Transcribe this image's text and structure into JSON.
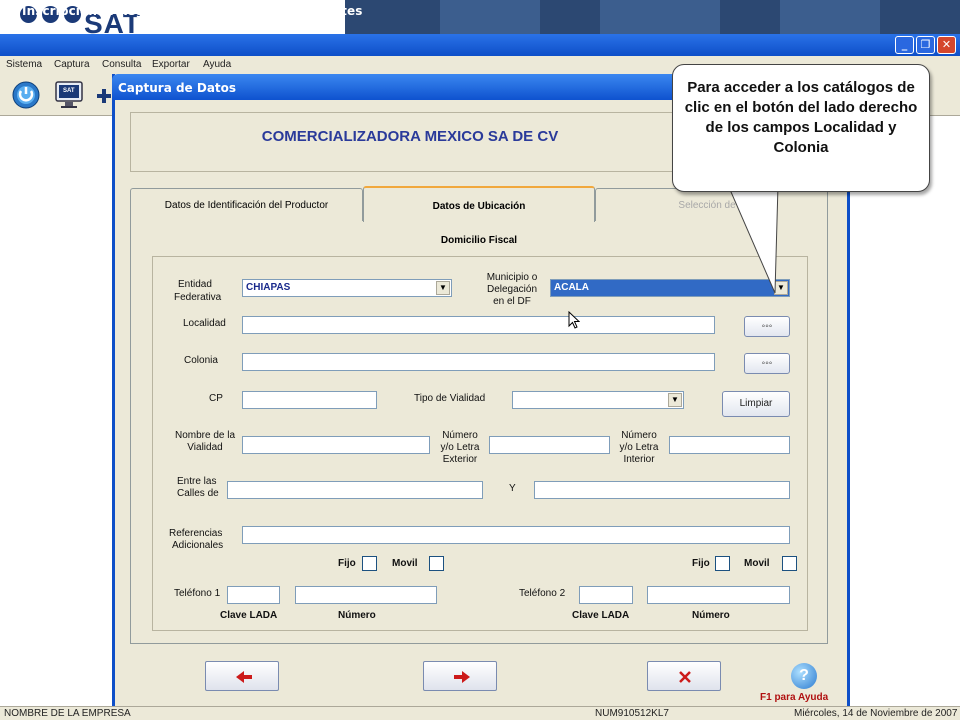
{
  "banner": {
    "logo_text": "SAT",
    "brand_color": "#1b3a78"
  },
  "window": {
    "title": "Inscripción al Registro Federal de Contribuyentes",
    "icon": "app-icon",
    "controls": {
      "minimize": "_",
      "maximize": "❐",
      "close": "✕"
    }
  },
  "menubar": {
    "items": [
      "Sistema",
      "Captura",
      "Consulta",
      "Exportar",
      "Ayuda"
    ]
  },
  "toolbar": {
    "icons": [
      "power-icon",
      "sat-icon",
      "add-icon"
    ],
    "sat_icon_label": "SAT"
  },
  "dialog": {
    "title": "Captura de Datos",
    "company": "COMERCIALIZADORA MEXICO SA DE CV",
    "tabs": [
      {
        "label": "Datos de Identificación del Productor",
        "active": false
      },
      {
        "label": "Datos de Ubicación",
        "active": true
      },
      {
        "label": "Selección de A",
        "active": false
      }
    ],
    "section_title": "Domicilio Fiscal",
    "form": {
      "entidad_label_1": "Entidad",
      "entidad_label_2": "Federativa",
      "entidad_value": "CHIAPAS",
      "municipio_label_1": "Municipio o",
      "municipio_label_2": "Delegación",
      "municipio_label_3": "en el DF",
      "municipio_value": "ACALA",
      "localidad_label": "Localidad",
      "colonia_label": "Colonia",
      "ellipsis_label": "◦◦◦",
      "cp_label": "CP",
      "tipo_vialidad_label": "Tipo de Vialidad",
      "limpiar_label": "Limpiar",
      "nombre_vialidad_1": "Nombre de la",
      "nombre_vialidad_2": "Vialidad",
      "numero_ext_1": "Número",
      "numero_ext_2": "y/o Letra",
      "numero_ext_3": "Exterior",
      "numero_int_1": "Número",
      "numero_int_2": "y/o Letra",
      "numero_int_3": "Interior",
      "entre_calles_1": "Entre las",
      "entre_calles_2": "Calles de",
      "y_label": "Y",
      "referencias_1": "Referencias",
      "referencias_2": "Adicionales",
      "fijo_label": "Fijo",
      "movil_label": "Movil",
      "telefono1_label": "Teléfono 1",
      "telefono2_label": "Teléfono 2",
      "clave_lada_label": "Clave LADA",
      "numero_label": "Número"
    },
    "nav": {
      "back_icon": "arrow-left-icon",
      "next_icon": "arrow-right-icon",
      "cancel_icon": "x-icon"
    },
    "help": {
      "glyph": "?",
      "label": "F1 para Ayuda"
    }
  },
  "callout": {
    "text": "Para acceder a los catálogos de clic en el botón del lado derecho de los campos Localidad y Colonia"
  },
  "statusbar": {
    "left": "NOMBRE DE LA EMPRESA",
    "middle": "NUM910512KL7",
    "right": "Miércoles, 14 de Noviembre de 2007"
  }
}
